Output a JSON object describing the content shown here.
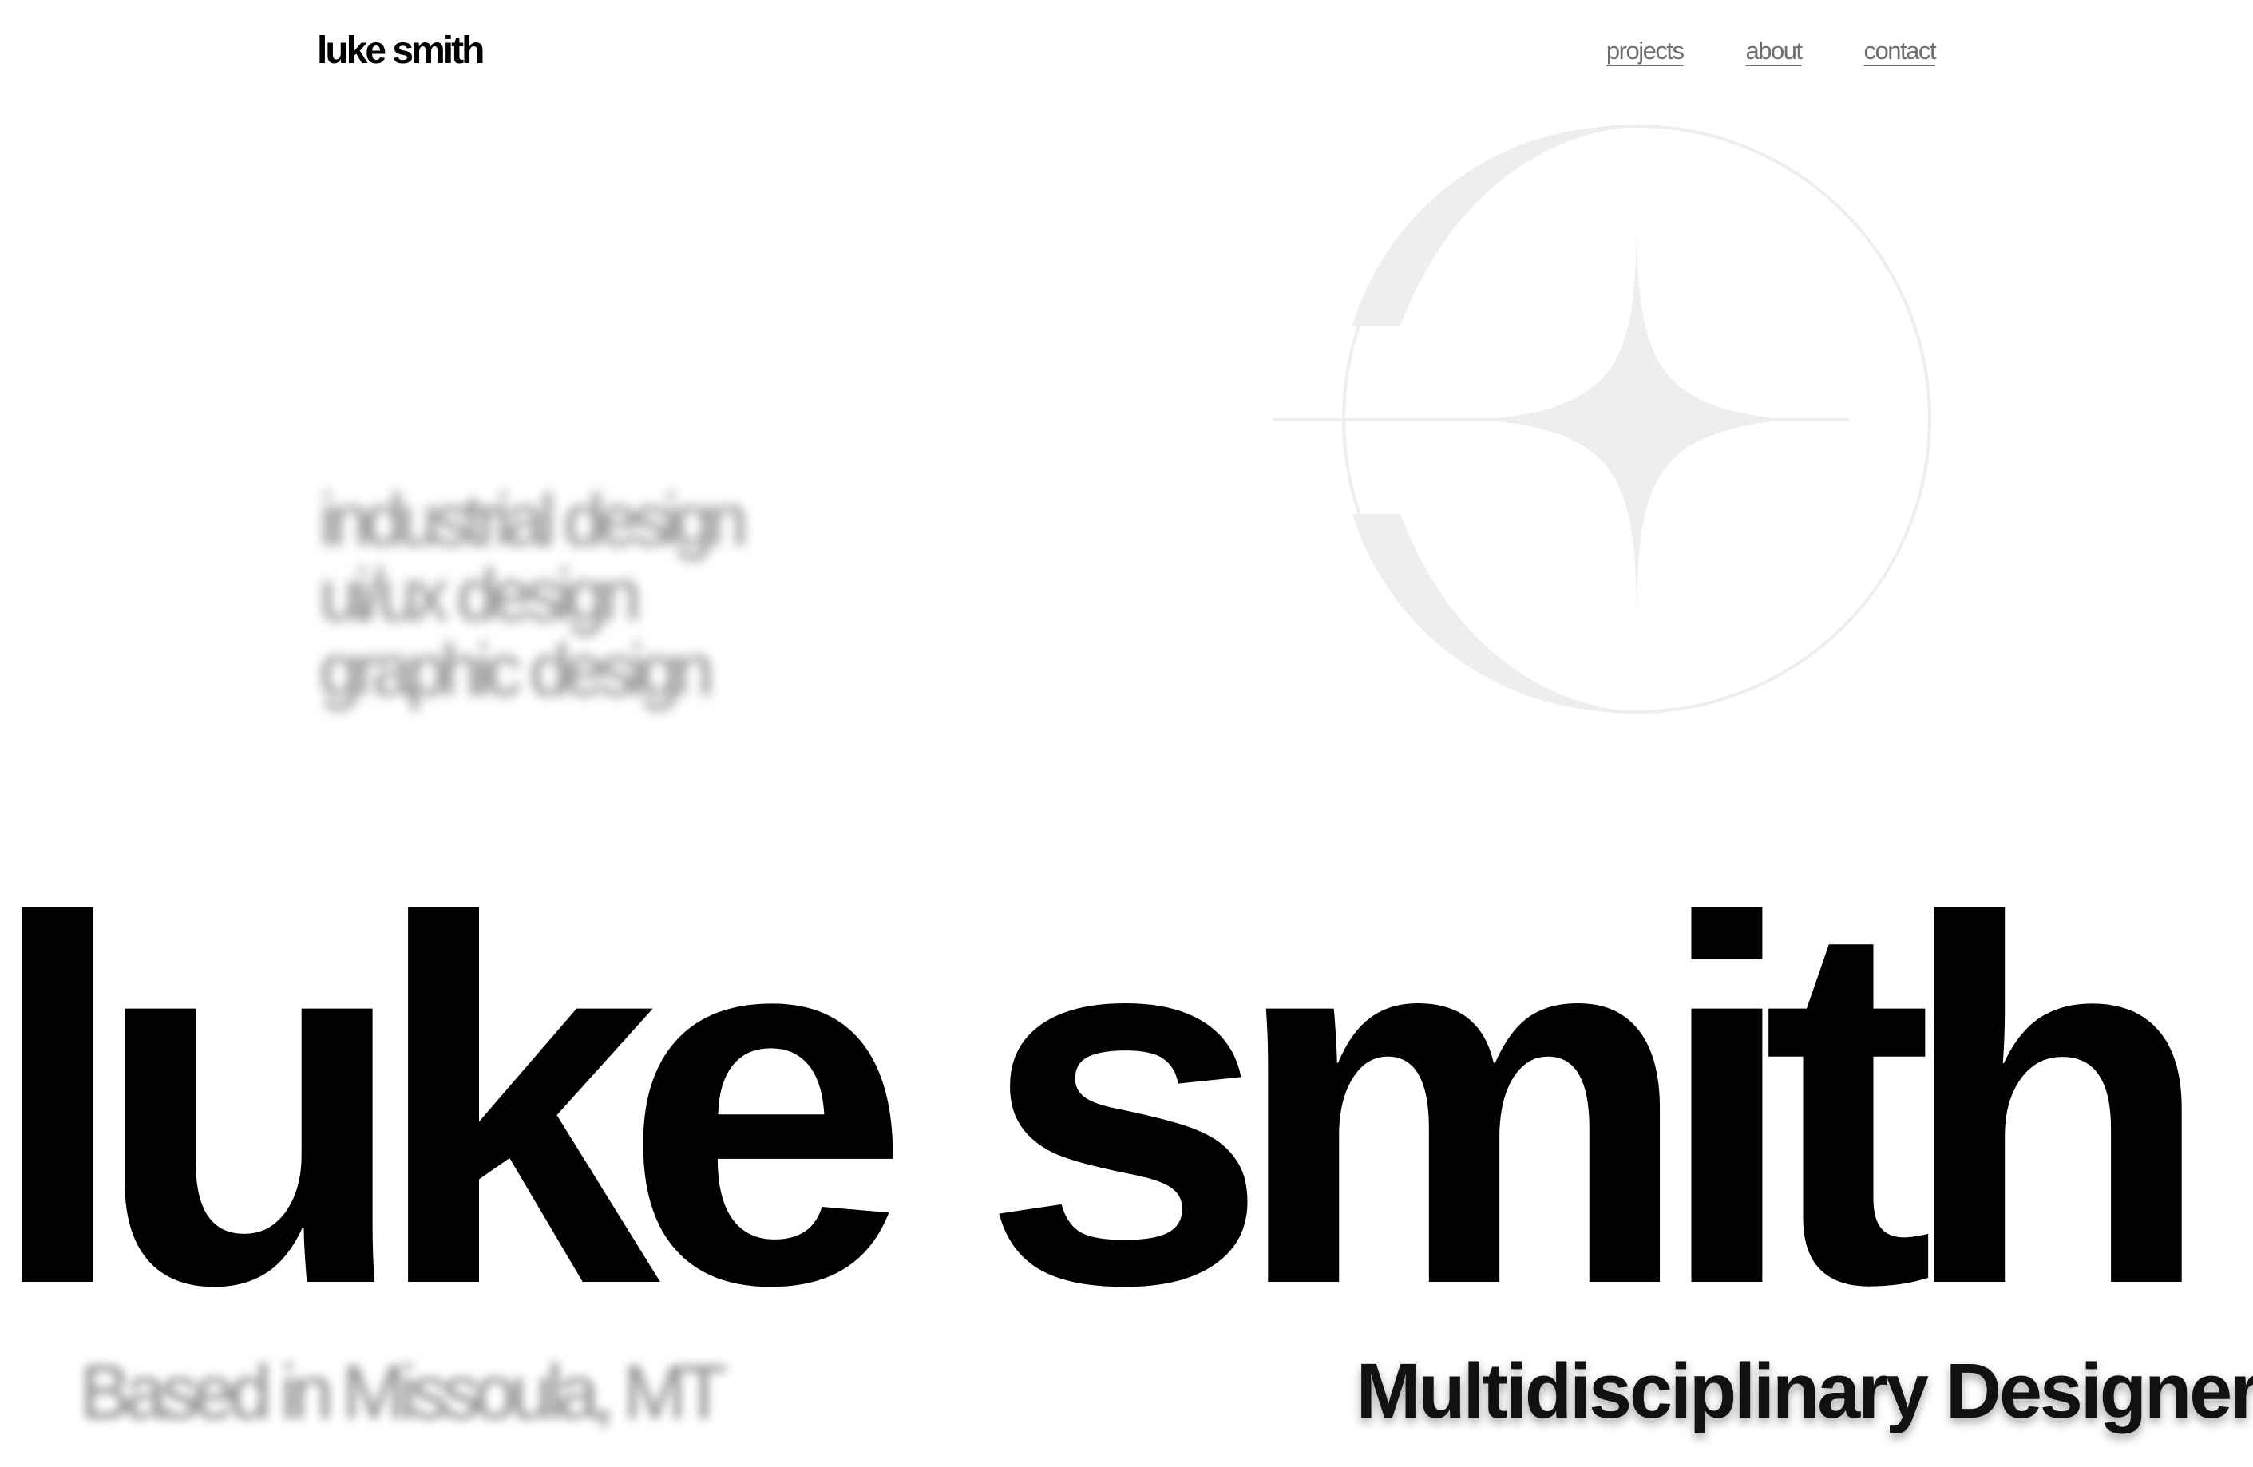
{
  "header": {
    "logo_text": "luke smith",
    "nav": [
      {
        "label": "projects"
      },
      {
        "label": "about"
      },
      {
        "label": "contact"
      }
    ]
  },
  "services": [
    "industrial design",
    "ui/ux design",
    "graphic design"
  ],
  "hero": {
    "name": "luke smith",
    "location": "Based in Missoula, MT",
    "role": "Multidisciplinary Designer"
  },
  "emblem": {
    "icon": "star-circle-emblem-icon",
    "color": "#eeeeee"
  },
  "colors": {
    "background": "#ffffff",
    "text": "#000000",
    "muted": "#8a8a8a",
    "emblem": "#eeeeee"
  }
}
